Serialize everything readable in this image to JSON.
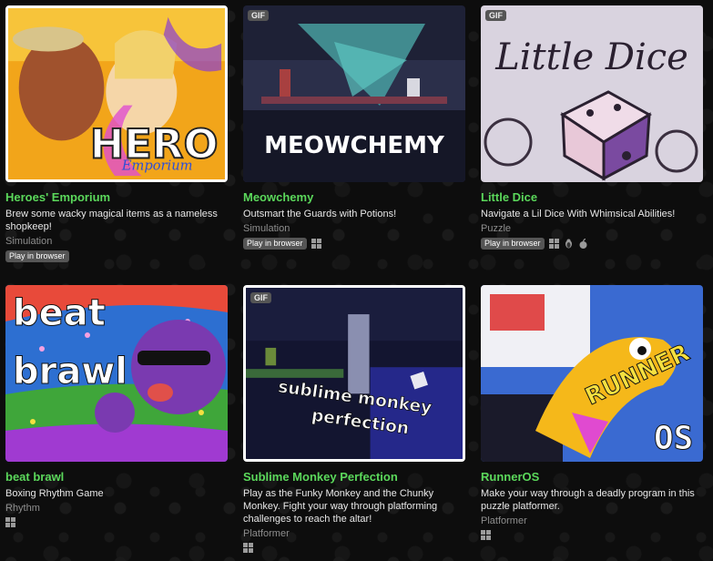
{
  "games": [
    {
      "title": "Heroes' Emporium",
      "description": "Brew some wacky magical items as a nameless shopkeep!",
      "genre": "Simulation",
      "badge": "",
      "play_in_browser": "Play in browser",
      "platforms": [],
      "art_text": [
        "HERO",
        "Emporium"
      ]
    },
    {
      "title": "Meowchemy",
      "description": "Outsmart the Guards with Potions!",
      "genre": "Simulation",
      "badge": "GIF",
      "play_in_browser": "Play in browser",
      "platforms": [
        "windows-icon"
      ],
      "art_text": [
        "MEOWCHEMY"
      ]
    },
    {
      "title": "Little Dice",
      "description": "Navigate a Lil Dice With Whimsical Abilities!",
      "genre": "Puzzle",
      "badge": "GIF",
      "play_in_browser": "Play in browser",
      "platforms": [
        "windows-icon",
        "linux-icon",
        "apple-icon"
      ],
      "art_text": [
        "Little Dice"
      ]
    },
    {
      "title": "beat brawl",
      "description": "Boxing Rhythm Game",
      "genre": "Rhythm",
      "badge": "",
      "play_in_browser": "",
      "platforms": [
        "windows-icon"
      ],
      "art_text": [
        "beat",
        "brawl"
      ]
    },
    {
      "title": "Sublime Monkey Perfection",
      "description": "Play as the Funky Monkey and the Chunky Monkey. Fight your way through platforming challenges to reach the altar!",
      "genre": "Platformer",
      "badge": "GIF",
      "play_in_browser": "",
      "platforms": [
        "windows-icon"
      ],
      "art_text": [
        "sublime monkey",
        "perfection"
      ]
    },
    {
      "title": "RunnerOS",
      "description": "Make your way through a deadly program in this puzzle platformer.",
      "genre": "Platformer",
      "badge": "",
      "play_in_browser": "",
      "platforms": [
        "windows-icon"
      ],
      "art_text": [
        "RUNNER",
        "OS"
      ]
    }
  ],
  "colors": {
    "title": "#5bd85b",
    "background": "#0d0d0d",
    "genre": "#8e8e8e"
  }
}
